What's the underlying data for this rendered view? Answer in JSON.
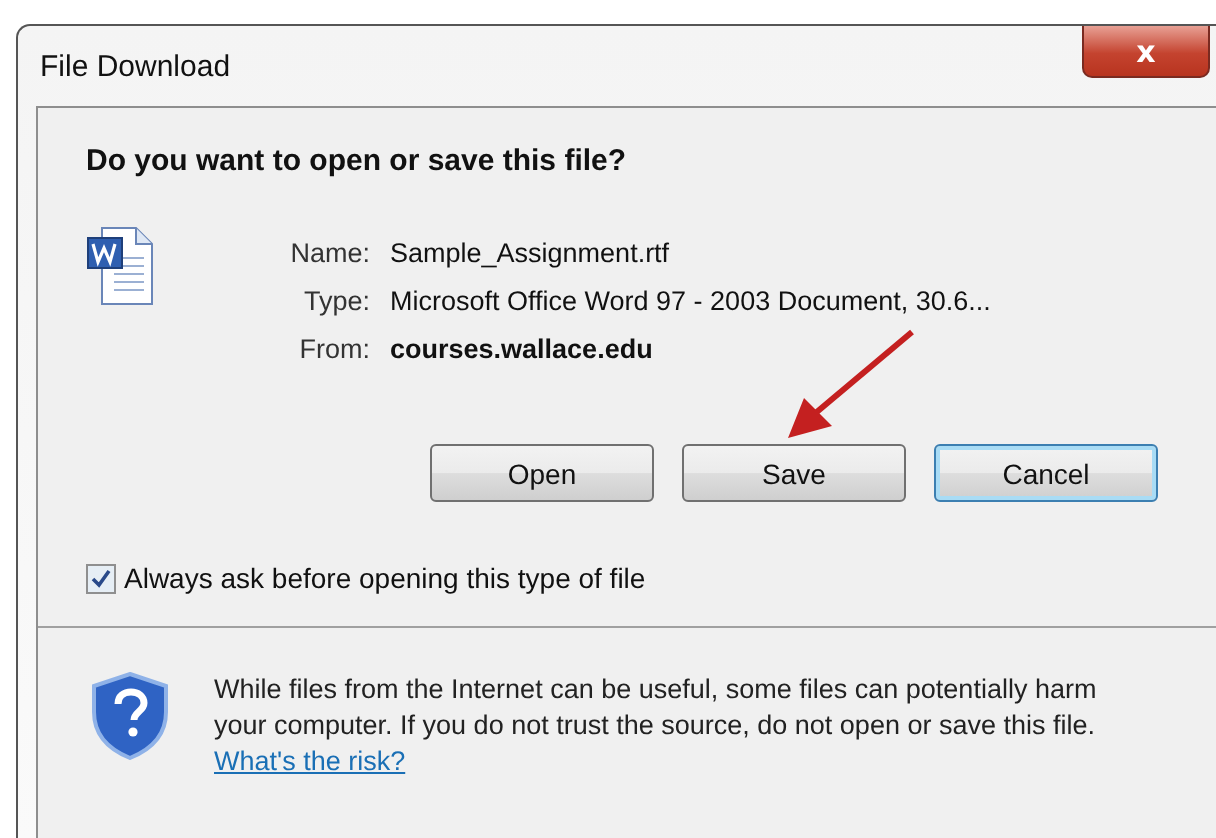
{
  "window": {
    "title": "File Download",
    "close": "x"
  },
  "heading": "Do you want to open or save this file?",
  "details": [
    {
      "label": "Name:",
      "value": "Sample_Assignment.rtf",
      "bold": false
    },
    {
      "label": "Type:",
      "value": "Microsoft Office Word 97 - 2003 Document, 30.6...",
      "bold": false
    },
    {
      "label": "From:",
      "value": "courses.wallace.edu",
      "bold": true
    }
  ],
  "buttons": [
    {
      "label": "Open",
      "default": false
    },
    {
      "label": "Save",
      "default": false
    },
    {
      "label": "Cancel",
      "default": true
    }
  ],
  "always_ask": {
    "label": "Always ask before opening this type of file",
    "checked": true
  },
  "warning": {
    "text": "While files from the Internet can be useful, some files can potentially harm your computer. If you do not trust the source, do not open or save this file.",
    "link": "What's the risk?"
  }
}
